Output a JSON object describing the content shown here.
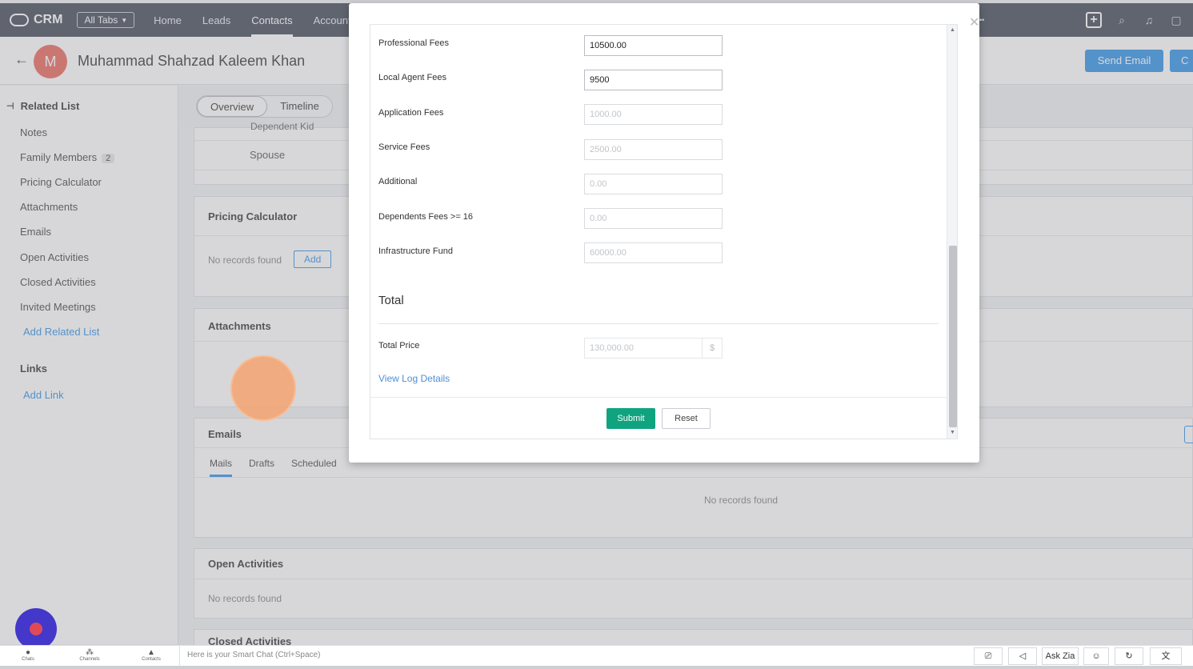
{
  "topbar": {
    "brand": "CRM",
    "all_tabs": "All Tabs",
    "nav": [
      "Home",
      "Leads",
      "Contacts",
      "Account"
    ]
  },
  "record": {
    "avatar_letter": "M",
    "name": "Muhammad Shahzad Kaleem Khan",
    "send_email": "Send Email",
    "second_button": "C"
  },
  "sidebar": {
    "title": "Related List",
    "items": [
      {
        "label": "Notes"
      },
      {
        "label": "Family Members",
        "badge": "2"
      },
      {
        "label": "Pricing Calculator"
      },
      {
        "label": "Attachments"
      },
      {
        "label": "Emails"
      },
      {
        "label": "Open Activities"
      },
      {
        "label": "Closed Activities"
      },
      {
        "label": "Invited Meetings"
      }
    ],
    "add_related": "Add Related List",
    "links_title": "Links",
    "add_link": "Add Link"
  },
  "main": {
    "tabs": [
      "Overview",
      "Timeline"
    ],
    "partial_row": "Dependent Kid",
    "spouse": "Spouse",
    "pricing_title": "Pricing Calculator",
    "no_records": "No records found",
    "add": "Add",
    "attachments_title": "Attachments",
    "emails_title": "Emails",
    "email_tabs": [
      "Mails",
      "Drafts",
      "Scheduled"
    ],
    "emails_empty": "No records found",
    "open_activities_title": "Open Activities",
    "open_activities_empty": "No records found",
    "closed_activities_title": "Closed Activities"
  },
  "modal": {
    "fields": [
      {
        "label": "Professional Fees",
        "value": "10500.00"
      },
      {
        "label": "Local Agent Fees",
        "value": "9500"
      },
      {
        "label": "Application Fees",
        "value": "1000.00"
      },
      {
        "label": "Service Fees",
        "value": "2500.00"
      },
      {
        "label": "Additional",
        "value": "0.00"
      },
      {
        "label": "Dependents Fees >= 16",
        "value": "0.00"
      },
      {
        "label": "Infrastructure Fund",
        "value": "60000.00"
      }
    ],
    "total_title": "Total",
    "total_price_label": "Total Price",
    "total_price_value": "130,000.00",
    "currency": "$",
    "view_log": "View Log Details",
    "submit": "Submit",
    "reset": "Reset"
  },
  "bottombar": {
    "left_icons": [
      "Chats",
      "Channels",
      "Contacts"
    ],
    "smart_chat": "Here is your Smart Chat (Ctrl+Space)",
    "ask_zia": "Ask Zia"
  }
}
